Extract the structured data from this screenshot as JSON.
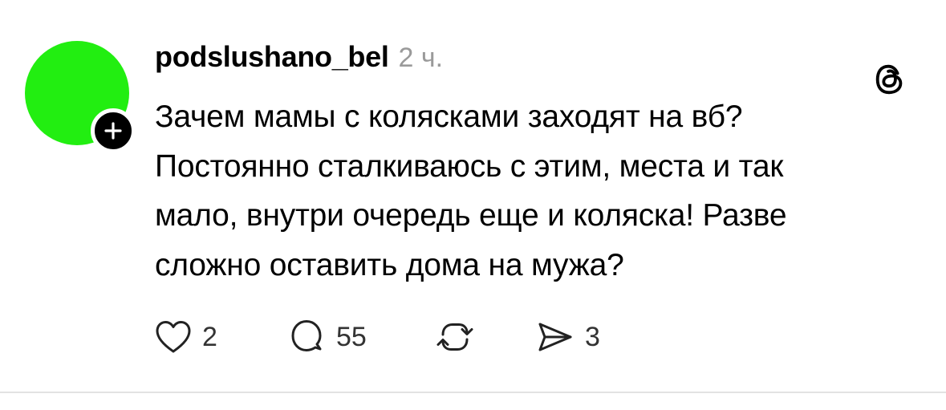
{
  "post": {
    "username": "podslushano_bel",
    "timestamp": "2 ч.",
    "text_lines": [
      "Зачем мамы с колясками заходят на вб?",
      "Постоянно сталкиваюсь с этим, места и так",
      "мало, внутри очередь еще и коляска! Разве",
      "сложно оставить дома на мужа?"
    ],
    "avatar_color": "#22ee11",
    "actions": {
      "like_count": "2",
      "reply_count": "55",
      "share_count": "3"
    }
  },
  "icons": {
    "follow": "plus-icon",
    "app": "threads-logo-icon",
    "like": "heart-icon",
    "reply": "comment-icon",
    "repost": "repost-icon",
    "share": "send-icon"
  }
}
